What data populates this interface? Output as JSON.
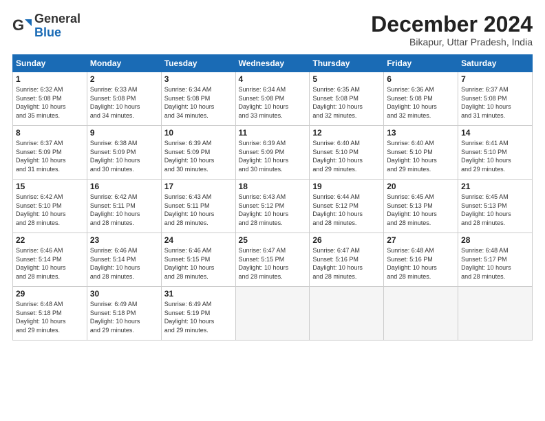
{
  "logo": {
    "line1": "General",
    "line2": "Blue"
  },
  "title": "December 2024",
  "subtitle": "Bikapur, Uttar Pradesh, India",
  "weekdays": [
    "Sunday",
    "Monday",
    "Tuesday",
    "Wednesday",
    "Thursday",
    "Friday",
    "Saturday"
  ],
  "weeks": [
    [
      {
        "day": "1",
        "info": "Sunrise: 6:32 AM\nSunset: 5:08 PM\nDaylight: 10 hours\nand 35 minutes."
      },
      {
        "day": "2",
        "info": "Sunrise: 6:33 AM\nSunset: 5:08 PM\nDaylight: 10 hours\nand 34 minutes."
      },
      {
        "day": "3",
        "info": "Sunrise: 6:34 AM\nSunset: 5:08 PM\nDaylight: 10 hours\nand 34 minutes."
      },
      {
        "day": "4",
        "info": "Sunrise: 6:34 AM\nSunset: 5:08 PM\nDaylight: 10 hours\nand 33 minutes."
      },
      {
        "day": "5",
        "info": "Sunrise: 6:35 AM\nSunset: 5:08 PM\nDaylight: 10 hours\nand 32 minutes."
      },
      {
        "day": "6",
        "info": "Sunrise: 6:36 AM\nSunset: 5:08 PM\nDaylight: 10 hours\nand 32 minutes."
      },
      {
        "day": "7",
        "info": "Sunrise: 6:37 AM\nSunset: 5:08 PM\nDaylight: 10 hours\nand 31 minutes."
      }
    ],
    [
      {
        "day": "8",
        "info": "Sunrise: 6:37 AM\nSunset: 5:09 PM\nDaylight: 10 hours\nand 31 minutes."
      },
      {
        "day": "9",
        "info": "Sunrise: 6:38 AM\nSunset: 5:09 PM\nDaylight: 10 hours\nand 30 minutes."
      },
      {
        "day": "10",
        "info": "Sunrise: 6:39 AM\nSunset: 5:09 PM\nDaylight: 10 hours\nand 30 minutes."
      },
      {
        "day": "11",
        "info": "Sunrise: 6:39 AM\nSunset: 5:09 PM\nDaylight: 10 hours\nand 30 minutes."
      },
      {
        "day": "12",
        "info": "Sunrise: 6:40 AM\nSunset: 5:10 PM\nDaylight: 10 hours\nand 29 minutes."
      },
      {
        "day": "13",
        "info": "Sunrise: 6:40 AM\nSunset: 5:10 PM\nDaylight: 10 hours\nand 29 minutes."
      },
      {
        "day": "14",
        "info": "Sunrise: 6:41 AM\nSunset: 5:10 PM\nDaylight: 10 hours\nand 29 minutes."
      }
    ],
    [
      {
        "day": "15",
        "info": "Sunrise: 6:42 AM\nSunset: 5:10 PM\nDaylight: 10 hours\nand 28 minutes."
      },
      {
        "day": "16",
        "info": "Sunrise: 6:42 AM\nSunset: 5:11 PM\nDaylight: 10 hours\nand 28 minutes."
      },
      {
        "day": "17",
        "info": "Sunrise: 6:43 AM\nSunset: 5:11 PM\nDaylight: 10 hours\nand 28 minutes."
      },
      {
        "day": "18",
        "info": "Sunrise: 6:43 AM\nSunset: 5:12 PM\nDaylight: 10 hours\nand 28 minutes."
      },
      {
        "day": "19",
        "info": "Sunrise: 6:44 AM\nSunset: 5:12 PM\nDaylight: 10 hours\nand 28 minutes."
      },
      {
        "day": "20",
        "info": "Sunrise: 6:45 AM\nSunset: 5:13 PM\nDaylight: 10 hours\nand 28 minutes."
      },
      {
        "day": "21",
        "info": "Sunrise: 6:45 AM\nSunset: 5:13 PM\nDaylight: 10 hours\nand 28 minutes."
      }
    ],
    [
      {
        "day": "22",
        "info": "Sunrise: 6:46 AM\nSunset: 5:14 PM\nDaylight: 10 hours\nand 28 minutes."
      },
      {
        "day": "23",
        "info": "Sunrise: 6:46 AM\nSunset: 5:14 PM\nDaylight: 10 hours\nand 28 minutes."
      },
      {
        "day": "24",
        "info": "Sunrise: 6:46 AM\nSunset: 5:15 PM\nDaylight: 10 hours\nand 28 minutes."
      },
      {
        "day": "25",
        "info": "Sunrise: 6:47 AM\nSunset: 5:15 PM\nDaylight: 10 hours\nand 28 minutes."
      },
      {
        "day": "26",
        "info": "Sunrise: 6:47 AM\nSunset: 5:16 PM\nDaylight: 10 hours\nand 28 minutes."
      },
      {
        "day": "27",
        "info": "Sunrise: 6:48 AM\nSunset: 5:16 PM\nDaylight: 10 hours\nand 28 minutes."
      },
      {
        "day": "28",
        "info": "Sunrise: 6:48 AM\nSunset: 5:17 PM\nDaylight: 10 hours\nand 28 minutes."
      }
    ],
    [
      {
        "day": "29",
        "info": "Sunrise: 6:48 AM\nSunset: 5:18 PM\nDaylight: 10 hours\nand 29 minutes."
      },
      {
        "day": "30",
        "info": "Sunrise: 6:49 AM\nSunset: 5:18 PM\nDaylight: 10 hours\nand 29 minutes."
      },
      {
        "day": "31",
        "info": "Sunrise: 6:49 AM\nSunset: 5:19 PM\nDaylight: 10 hours\nand 29 minutes."
      },
      {
        "day": "",
        "info": ""
      },
      {
        "day": "",
        "info": ""
      },
      {
        "day": "",
        "info": ""
      },
      {
        "day": "",
        "info": ""
      }
    ]
  ]
}
